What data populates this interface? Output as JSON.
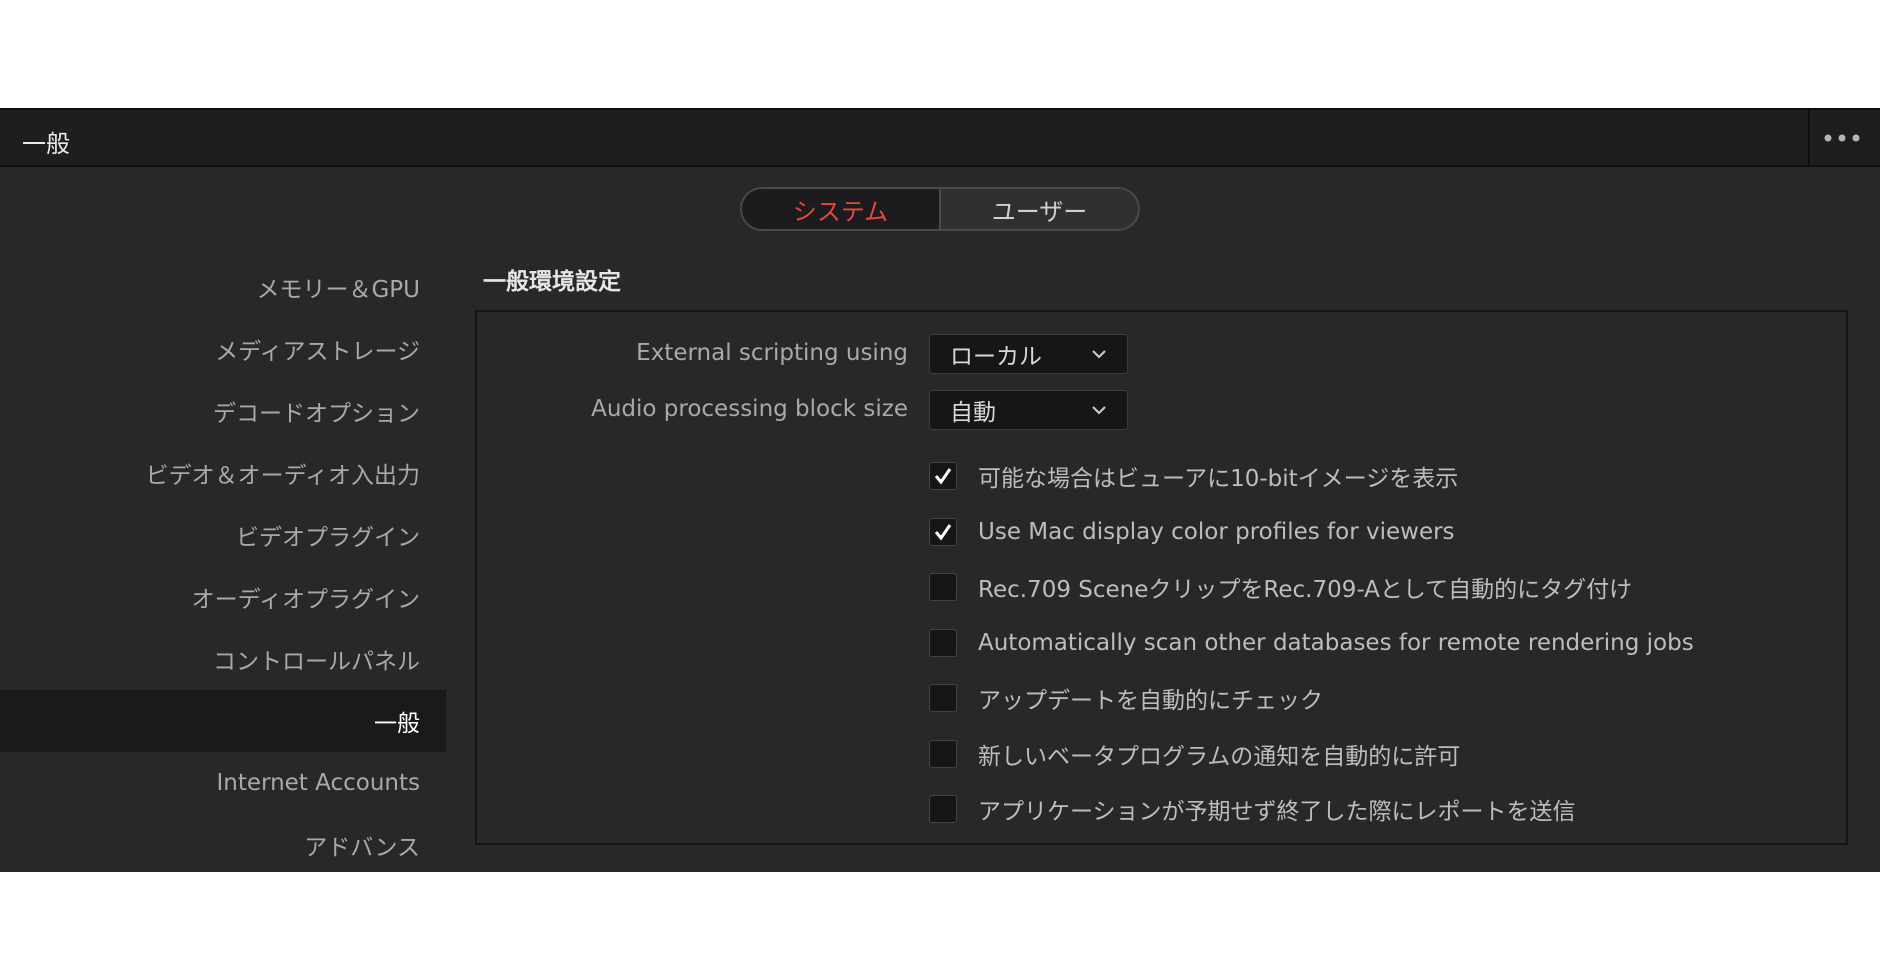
{
  "window": {
    "title": "一般"
  },
  "tabs": {
    "system": "システム",
    "user": "ユーザー"
  },
  "sidebar": {
    "items": [
      {
        "label": "メモリー＆GPU"
      },
      {
        "label": "メディアストレージ"
      },
      {
        "label": "デコードオプション"
      },
      {
        "label": "ビデオ＆オーディオ入出力"
      },
      {
        "label": "ビデオプラグイン"
      },
      {
        "label": "オーディオプラグイン"
      },
      {
        "label": "コントロールパネル"
      },
      {
        "label": "一般"
      },
      {
        "label": "Internet Accounts"
      },
      {
        "label": "アドバンス"
      }
    ],
    "active": "一般"
  },
  "section": {
    "title": "一般環境設定",
    "external_scripting": {
      "label": "External scripting using",
      "value": "ローカル"
    },
    "audio_block_size": {
      "label": "Audio processing block size",
      "value": "自動"
    },
    "options": [
      {
        "label": "可能な場合はビューアに10-bitイメージを表示",
        "checked": true
      },
      {
        "label": "Use Mac display color profiles for viewers",
        "checked": true
      },
      {
        "label": "Rec.709 SceneクリップをRec.709-Aとして自動的にタグ付け",
        "checked": false
      },
      {
        "label": "Automatically scan other databases for remote rendering jobs",
        "checked": false
      },
      {
        "label": "アップデートを自動的にチェック",
        "checked": false
      },
      {
        "label": "新しいベータプログラムの通知を自動的に許可",
        "checked": false
      },
      {
        "label": "アプリケーションが予期せず終了した際にレポートを送信",
        "checked": false
      }
    ]
  },
  "colors": {
    "accent": "#e8463c",
    "background": "#28282a",
    "panel_border": "#141414"
  },
  "icons": {
    "more": "ellipsis-icon",
    "dropdown": "chevron-down-icon",
    "check": "checkmark-icon"
  }
}
